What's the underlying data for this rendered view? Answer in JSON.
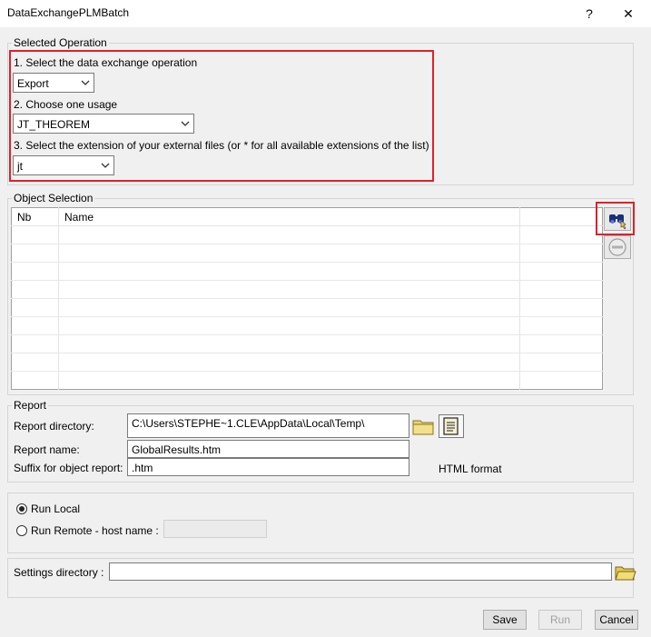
{
  "window": {
    "title": "DataExchangePLMBatch",
    "help": "?",
    "close": "✕"
  },
  "selected_operation": {
    "legend": "Selected Operation",
    "step1_label": "1. Select the data exchange operation",
    "step1_value": "Export",
    "step2_label": "2. Choose one usage",
    "step2_value": "JT_THEOREM",
    "step3_label": "3. Select the extension of your external files (or * for all available extensions of the list)",
    "step3_value": "jt"
  },
  "object_selection": {
    "legend": "Object Selection",
    "columns": [
      "Nb",
      "Name",
      ""
    ]
  },
  "report": {
    "legend": "Report",
    "dir_label": "Report directory:",
    "dir_value": "C:\\Users\\STEPHE~1.CLE\\AppData\\Local\\Temp\\",
    "name_label": "Report name:",
    "name_value": "GlobalResults.htm",
    "suffix_label": "Suffix for object report:",
    "suffix_value": ".htm",
    "format_text": "HTML format"
  },
  "run": {
    "local_label": "Run Local",
    "remote_label": "Run Remote - host name :",
    "host_value": "",
    "selected": "local"
  },
  "settings": {
    "label": "Settings directory :",
    "value": ""
  },
  "buttons": {
    "save": "Save",
    "run": "Run",
    "cancel": "Cancel"
  },
  "colors": {
    "highlight": "#e0202a",
    "background": "#f0f0f0"
  }
}
